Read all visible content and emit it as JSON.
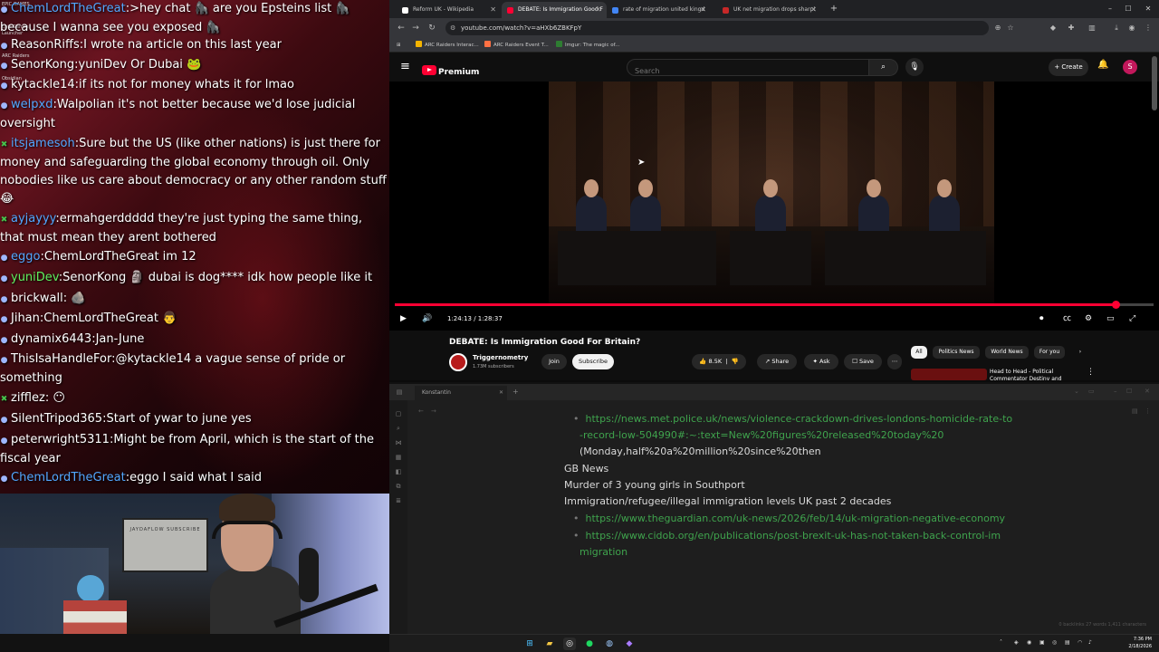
{
  "desktop_icons": [
    "EPIC GAMES",
    "Epic Games Launcher",
    "ARC Raiders",
    "Obsidian"
  ],
  "chat": [
    {
      "badge": "mod",
      "user": "ChemLordTheGreat",
      "user_color": "c-blue",
      "text": ":>hey chat 🦍 are you Epsteins list 🦍 because I wanna see you exposed 🦍"
    },
    {
      "badge": "",
      "user": "ReasonRiffs",
      "user_color": "c-white",
      "text": ":I wrote na article on this last year"
    },
    {
      "badge": "",
      "user": "SenorKong",
      "user_color": "c-white",
      "text": ":yuniDev Or Dubai 🐸"
    },
    {
      "badge": "",
      "user": "kytackle14",
      "user_color": "c-white",
      "text": ":if its not for money whats it for lmao"
    },
    {
      "badge": "",
      "user": "welpxd",
      "user_color": "c-blue",
      "text": ":Walpolian it's not better because we'd lose judicial oversight"
    },
    {
      "badge": "sub",
      "user": "itsjamesoh",
      "user_color": "c-blue",
      "text": ":Sure but the US (like other nations) is just there for money and safeguarding the global economy through oil. Only nobodies like us care about democracy or any other random stuff 😂"
    },
    {
      "badge": "sub",
      "user": "ayjayyy",
      "user_color": "c-blue",
      "text": ":ermahgerddddd they're just typing the same thing, that must mean they arent bothered"
    },
    {
      "badge": "",
      "user": "eggo",
      "user_color": "c-blue",
      "text": ":ChemLordTheGreat im 12"
    },
    {
      "badge": "",
      "user": "yuniDev",
      "user_color": "c-green",
      "text": ":SenorKong 🗿 dubai is dog**** idk how people like it"
    },
    {
      "badge": "",
      "user": "brickwall",
      "user_color": "c-white",
      "text": ": 🪨"
    },
    {
      "badge": "",
      "user": "Jihan",
      "user_color": "c-white",
      "text": ":ChemLordTheGreat 👨"
    },
    {
      "badge": "",
      "user": "dynamix6443",
      "user_color": "c-white",
      "text": ":Jan-June"
    },
    {
      "badge": "",
      "user": "ThisIsaHandleFor",
      "user_color": "c-white",
      "text": ":@kytackle14 a vague sense of pride or something"
    },
    {
      "badge": "sub",
      "user": "zifflez",
      "user_color": "c-white",
      "text": ": 😶"
    },
    {
      "badge": "",
      "user": "SilentTripod365",
      "user_color": "c-white",
      "text": ":Start of ywar to june yes"
    },
    {
      "badge": "",
      "user": "peterwright5311",
      "user_color": "c-white",
      "text": ":Might be from April, which is the start of the fiscal year"
    },
    {
      "badge": "",
      "user": "ChemLordTheGreat",
      "user_color": "c-blue",
      "text": ":eggo I said what I said"
    }
  ],
  "webcam": {
    "poster_text": "JAYDAFLOW SUBSCRIBE"
  },
  "browser": {
    "tabs": [
      {
        "title": "Reform UK - Wikipedia",
        "fav": "#ffffff",
        "active": false
      },
      {
        "title": "DEBATE: Is Immigration Good F",
        "fav": "#ff0033",
        "active": true
      },
      {
        "title": "rate of migration united kingd",
        "fav": "#4285f4",
        "active": false
      },
      {
        "title": "UK net migration drops sharpl",
        "fav": "#c62828",
        "active": false
      }
    ],
    "url": "youtube.com/watch?v=aHXb6ZBKFpY",
    "bookmarks": [
      "ARC Raiders Interac...",
      "ARC Raiders Event T...",
      "Imgur: The magic of..."
    ]
  },
  "youtube": {
    "logo_text": "Premium",
    "search_placeholder": "Search",
    "create_label": "Create",
    "avatar_letter": "S",
    "time": "1:24:13 / 1:28:37",
    "progress": 0.95,
    "video_title": "DEBATE: Is Immigration Good For Britain?",
    "channel": "Triggernometry",
    "subscribers": "1.73M subscribers",
    "join": "Join",
    "subscribe": "Subscribe",
    "likes": "8.5K",
    "share": "Share",
    "ask": "Ask",
    "save": "Save",
    "chips": [
      "All",
      "Politics News",
      "World News",
      "For you"
    ],
    "rec_title": "Head to Head - Political Commentator Destiny and"
  },
  "notes": {
    "tab": "Konstantin",
    "lines": [
      {
        "type": "link",
        "text": "https://news.met.police.uk/news/violence-crackdown-drives-londons-homicide-rate-to"
      },
      {
        "type": "link-cont",
        "text": "-record-low-504990#:~:text=New%20figures%20released%20today%20"
      },
      {
        "type": "text-indent",
        "text": "(Monday,half%20a%20million%20since%20then"
      },
      {
        "type": "text",
        "text": "GB News"
      },
      {
        "type": "text",
        "text": "Murder of 3 young girls in Southport"
      },
      {
        "type": "text",
        "text": "Immigration/refugee/illegal immigration levels UK past 2 decades"
      },
      {
        "type": "link",
        "text": "https://www.theguardian.com/uk-news/2026/feb/14/uk-migration-negative-economy"
      },
      {
        "type": "link",
        "text": "https://www.cidob.org/en/publications/post-brexit-uk-has-not-taken-back-control-im"
      },
      {
        "type": "link-cont",
        "text": "migration"
      }
    ],
    "status": "0 backlinks   27 words   1,411 characters"
  },
  "clock": {
    "time": "7:36 PM",
    "date": "2/18/2026"
  }
}
